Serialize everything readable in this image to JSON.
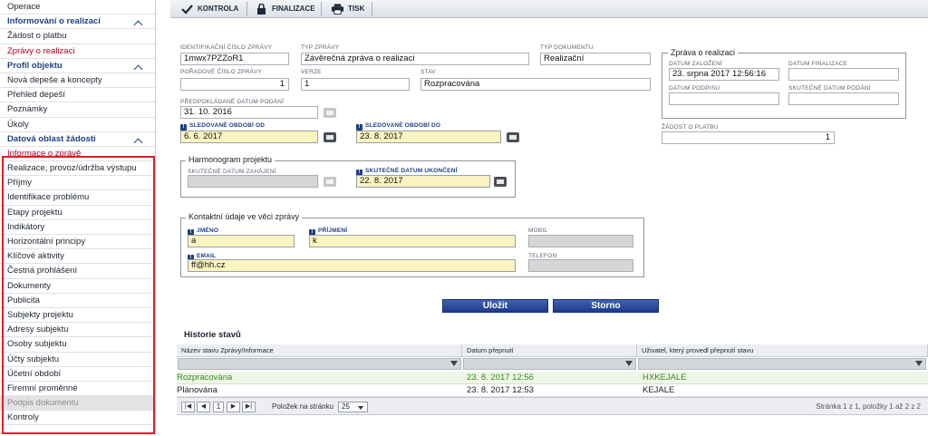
{
  "sidebar": {
    "items": [
      {
        "label": "Operace",
        "kind": "item"
      },
      {
        "label": "Informování o realizaci",
        "kind": "section"
      },
      {
        "label": "Žádost o platbu",
        "kind": "item"
      },
      {
        "label": "Zprávy o realizaci",
        "kind": "active"
      },
      {
        "label": "Profil objektu",
        "kind": "section"
      },
      {
        "label": "Nová depeše a koncepty",
        "kind": "item"
      },
      {
        "label": "Přehled depeší",
        "kind": "item"
      },
      {
        "label": "Poznámky",
        "kind": "item"
      },
      {
        "label": "Úkoly",
        "kind": "item"
      },
      {
        "label": "Datová oblast žádosti",
        "kind": "section"
      },
      {
        "label": "Informace o zprávě",
        "kind": "active"
      },
      {
        "label": "Realizace, provoz/údržba výstupu",
        "kind": "item"
      },
      {
        "label": "Příjmy",
        "kind": "item"
      },
      {
        "label": "Identifikace problému",
        "kind": "item"
      },
      {
        "label": "Etapy projektu",
        "kind": "item"
      },
      {
        "label": "Indikátory",
        "kind": "item"
      },
      {
        "label": "Horizontální principy",
        "kind": "item"
      },
      {
        "label": "Klíčové aktivity",
        "kind": "item"
      },
      {
        "label": "Čestná prohlášení",
        "kind": "item"
      },
      {
        "label": "Dokumenty",
        "kind": "item"
      },
      {
        "label": "Publicita",
        "kind": "item"
      },
      {
        "label": "Subjekty projektu",
        "kind": "item"
      },
      {
        "label": "Adresy subjektu",
        "kind": "item"
      },
      {
        "label": "Osoby subjektu",
        "kind": "item"
      },
      {
        "label": "Účty subjektu",
        "kind": "item"
      },
      {
        "label": "Účetní období",
        "kind": "item"
      },
      {
        "label": "Firemní proměnné",
        "kind": "item"
      },
      {
        "label": "Podpis dokumentu",
        "kind": "disabled"
      },
      {
        "label": "Kontroly",
        "kind": "item"
      }
    ]
  },
  "toolbar": {
    "kontrola": "KONTROLA",
    "finalizace": "FINALIZACE",
    "tisk": "TISK"
  },
  "form": {
    "id_label": "IDENTIFIKAČNÍ ČÍSLO ZPRÁVY",
    "id_value": "1mwx7PZZoR1",
    "typ_zpravy_label": "TYP ZPRÁVY",
    "typ_zpravy_value": "Závěrečná zpráva o realizaci",
    "typ_dokumentu_label": "TYP DOKUMENTU",
    "typ_dokumentu_value": "Realizační",
    "poradove_label": "POŘADOVÉ ČÍSLO ZPRÁVY",
    "poradove_value": "1",
    "verze_label": "VERZE",
    "verze_value": "1",
    "stav_label": "STAV",
    "stav_value": "Rozpracována",
    "predpokladane_label": "PŘEDPOKLÁDANÉ DATUM PODÁNÍ",
    "predpokladane_value": "31. 10. 2016",
    "obdobi_od_label": "SLEDOVANÉ OBDOBÍ OD",
    "obdobi_od_value": "6. 6. 2017",
    "obdobi_do_label": "SLEDOVANÉ OBDOBÍ DO",
    "obdobi_do_value": "23. 8. 2017",
    "zprava_legend": "Zpráva o realizaci",
    "datum_zalozeni_label": "DATUM ZALOŽENÍ",
    "datum_zalozeni_value": "23. srpna 2017 12:56:16",
    "datum_finalizace_label": "DATUM FINALIZACE",
    "datum_podpisu_label": "DATUM PODPISU",
    "skutecne_podani_label": "SKUTEČNÉ DATUM PODÁNÍ",
    "zadost_label": "ŽÁDOST O PLATBU",
    "zadost_value": "1",
    "harmonogram_legend": "Harmonogram projektu",
    "zahajeni_label": "SKUTEČNÉ DATUM ZAHÁJENÍ",
    "ukonceni_label": "SKUTEČNÉ DATUM UKONČENÍ",
    "ukonceni_value": "22. 8. 2017",
    "kontakt_legend": "Kontaktní údaje ve věci zprávy",
    "jmeno_label": "JMÉNO",
    "jmeno_value": "a",
    "prijmeni_label": "PŘÍJMENÍ",
    "prijmeni_value": "k",
    "mobil_label": "MOBIL",
    "email_label": "EMAIL",
    "email_value": "ff@hh.cz",
    "telefon_label": "TELEFON",
    "required_marker": "!"
  },
  "buttons": {
    "save": "Uložit",
    "cancel": "Storno"
  },
  "history": {
    "title": "Historie stavů",
    "columns": [
      "Název stavu Zprávy/Informace",
      "Datum přepnutí",
      "Uživatel, který provedl přepnutí stavu"
    ],
    "rows": [
      [
        "Rozpracována",
        "23. 8. 2017 12:56",
        "HXKEJALE"
      ],
      [
        "Plánována",
        "23. 8. 2017 12:53",
        "KEJALE"
      ]
    ]
  },
  "pager": {
    "first": "|◀",
    "prev": "◀",
    "page": "1",
    "next": "▶",
    "last": "▶|",
    "per_page_label": "Položek na stránku",
    "per_page_value": "25",
    "summary": "Stránka 1 z 1, položky 1 až 2 z 2"
  },
  "colors": {
    "accent": "#1f3f83",
    "active_nav": "#b00020",
    "highlight_box": "#e01f26",
    "required_field": "#fbf3c0",
    "current_state": "#2f8a1a"
  }
}
